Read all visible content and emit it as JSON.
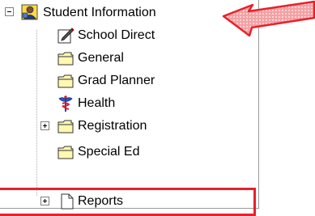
{
  "tree": {
    "root": {
      "label": "Student Information",
      "expanded": true,
      "icon": "student-info-icon"
    },
    "children": [
      {
        "label": "School Direct",
        "icon": "edit-note-icon",
        "expandable": false
      },
      {
        "label": "General",
        "icon": "folder-icon",
        "expandable": false
      },
      {
        "label": "Grad Planner",
        "icon": "folder-icon",
        "expandable": false
      },
      {
        "label": "Health",
        "icon": "caduceus-icon",
        "expandable": false
      },
      {
        "label": "Registration",
        "icon": "folder-icon",
        "expandable": true
      },
      {
        "label": "Special Ed",
        "icon": "folder-icon",
        "expandable": false
      },
      {
        "label": "Reports",
        "icon": "document-icon",
        "expandable": true
      }
    ]
  },
  "annotations": {
    "arrow_color": "#e8212a",
    "highlight_color": "#e8212a",
    "arrow_target": "Student Information",
    "highlighted_item": "Reports"
  }
}
